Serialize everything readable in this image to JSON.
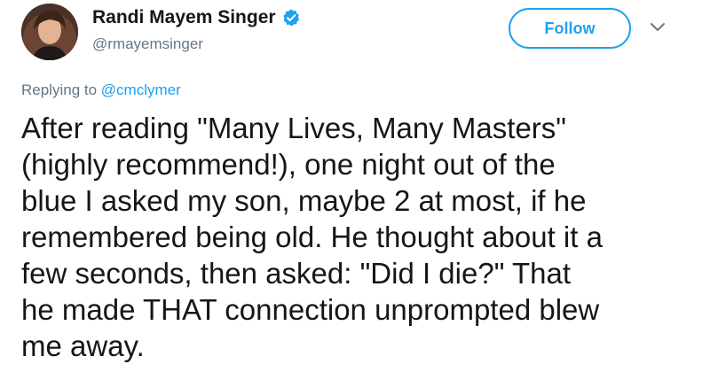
{
  "author": {
    "display_name": "Randi Mayem Singer",
    "handle": "@rmayemsinger",
    "verified": true,
    "avatar_icon": "profile-photo"
  },
  "actions": {
    "follow_label": "Follow",
    "menu_icon": "chevron-down-icon"
  },
  "reply_context": {
    "prefix": "Replying to",
    "mention": "@cmclymer"
  },
  "tweet": {
    "lines": [
      "After reading \"Many Lives, Many Masters\"",
      "(highly recommend!), one night out of the",
      "blue I asked my son, maybe 2 at most, if he",
      "remembered being old. He thought about it a",
      "few seconds, then asked: \"Did I die?\" That",
      "he made THAT connection unprompted blew",
      "me away."
    ]
  },
  "colors": {
    "accent": "#1da1f2",
    "text": "#14171a",
    "secondary": "#657786"
  }
}
